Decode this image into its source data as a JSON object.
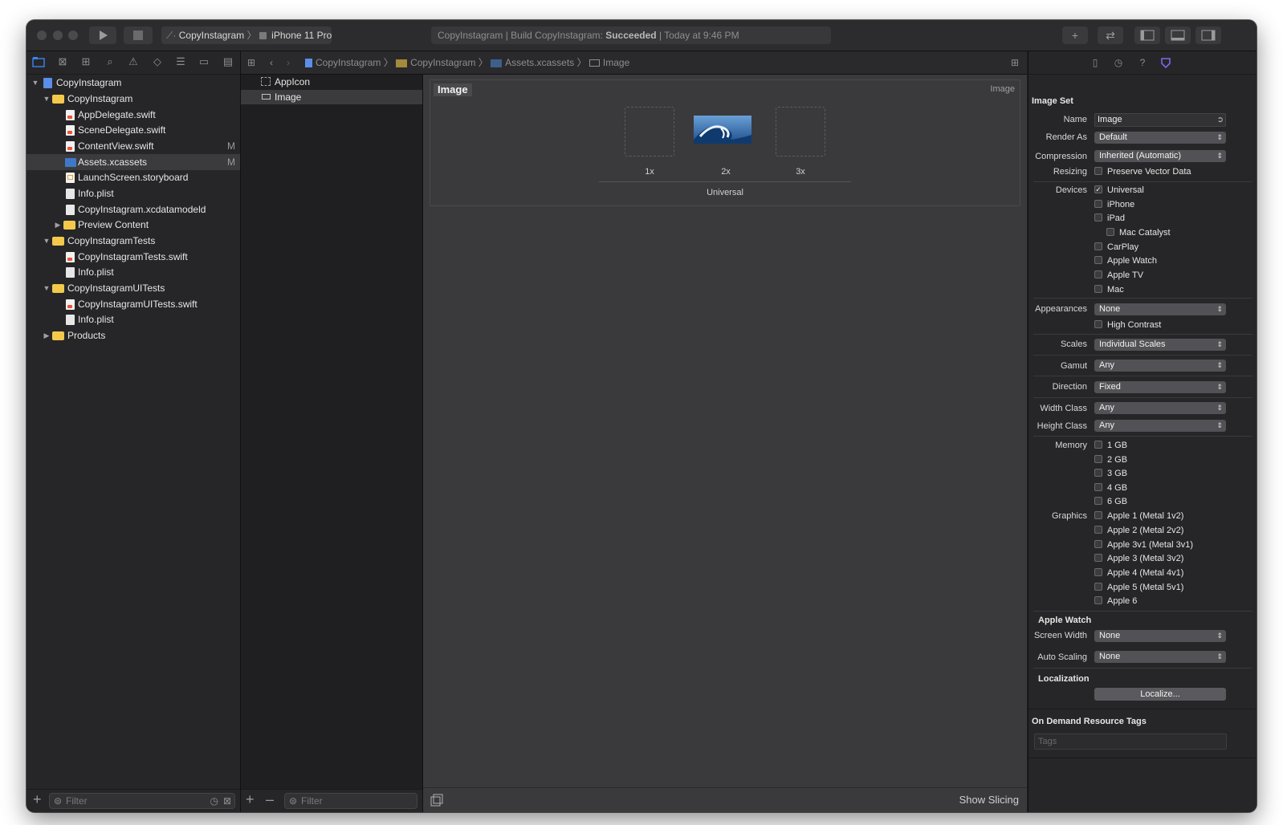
{
  "window": {
    "scheme_project": "CopyInstagram",
    "scheme_device": "iPhone 11 Pro",
    "activity_prefix": "CopyInstagram | Build CopyInstagram:",
    "activity_status": "Succeeded",
    "activity_time": "| Today at 9:46 PM"
  },
  "navigator": {
    "items": [
      {
        "label": "CopyInstagram",
        "badge": ""
      },
      {
        "label": "CopyInstagram",
        "badge": ""
      },
      {
        "label": "AppDelegate.swift",
        "badge": ""
      },
      {
        "label": "SceneDelegate.swift",
        "badge": ""
      },
      {
        "label": "ContentView.swift",
        "badge": "M"
      },
      {
        "label": "Assets.xcassets",
        "badge": "M"
      },
      {
        "label": "LaunchScreen.storyboard",
        "badge": ""
      },
      {
        "label": "Info.plist",
        "badge": ""
      },
      {
        "label": "CopyInstagram.xcdatamodeld",
        "badge": ""
      },
      {
        "label": "Preview Content",
        "badge": ""
      },
      {
        "label": "CopyInstagramTests",
        "badge": ""
      },
      {
        "label": "CopyInstagramTests.swift",
        "badge": ""
      },
      {
        "label": "Info.plist",
        "badge": ""
      },
      {
        "label": "CopyInstagramUITests",
        "badge": ""
      },
      {
        "label": "CopyInstagramUITests.swift",
        "badge": ""
      },
      {
        "label": "Info.plist",
        "badge": ""
      },
      {
        "label": "Products",
        "badge": ""
      }
    ],
    "filter_placeholder": "Filter"
  },
  "jumpbar": {
    "crumbs": [
      "CopyInstagram",
      "CopyInstagram",
      "Assets.xcassets",
      "Image"
    ]
  },
  "assets": {
    "items": [
      "AppIcon",
      "Image"
    ],
    "filter_placeholder": "Filter"
  },
  "editor": {
    "set_name": "Image",
    "set_kind": "Image",
    "slots": [
      "1x",
      "2x",
      "3x"
    ],
    "group_label": "Universal",
    "show_slicing": "Show Slicing"
  },
  "inspector": {
    "section_title": "Image Set",
    "name_label": "Name",
    "name_value": "Image",
    "render_as_label": "Render As",
    "render_as_value": "Default",
    "compression_label": "Compression",
    "compression_value": "Inherited (Automatic)",
    "resizing_label": "Resizing",
    "resizing_option": "Preserve Vector Data",
    "devices_label": "Devices",
    "devices": [
      {
        "label": "Universal",
        "checked": true
      },
      {
        "label": "iPhone",
        "checked": false
      },
      {
        "label": "iPad",
        "checked": false
      },
      {
        "label": "Mac Catalyst",
        "checked": false
      },
      {
        "label": "CarPlay",
        "checked": false
      },
      {
        "label": "Apple Watch",
        "checked": false
      },
      {
        "label": "Apple TV",
        "checked": false
      },
      {
        "label": "Mac",
        "checked": false
      }
    ],
    "appearances_label": "Appearances",
    "appearances_value": "None",
    "high_contrast": "High Contrast",
    "scales_label": "Scales",
    "scales_value": "Individual Scales",
    "gamut_label": "Gamut",
    "gamut_value": "Any",
    "direction_label": "Direction",
    "direction_value": "Fixed",
    "width_class_label": "Width Class",
    "width_class_value": "Any",
    "height_class_label": "Height Class",
    "height_class_value": "Any",
    "memory_label": "Memory",
    "memory": [
      "1 GB",
      "2 GB",
      "3 GB",
      "4 GB",
      "6 GB"
    ],
    "graphics_label": "Graphics",
    "graphics": [
      "Apple 1 (Metal 1v2)",
      "Apple 2 (Metal 2v2)",
      "Apple 3v1 (Metal 3v1)",
      "Apple 3 (Metal 3v2)",
      "Apple 4 (Metal 4v1)",
      "Apple 5 (Metal 5v1)",
      "Apple 6"
    ],
    "watch_section": "Apple Watch",
    "screen_width_label": "Screen Width",
    "screen_width_value": "None",
    "auto_scaling_label": "Auto Scaling",
    "auto_scaling_value": "None",
    "localization_section": "Localization",
    "localize_button": "Localize...",
    "odr_section": "On Demand Resource Tags",
    "tags_placeholder": "Tags"
  },
  "colors": {
    "window_bg": "#1f1f21",
    "panel_bg": "#262628",
    "editor_bg": "#3a3a3c",
    "folder": "#f3c94c",
    "accent": "#6a5acd"
  }
}
